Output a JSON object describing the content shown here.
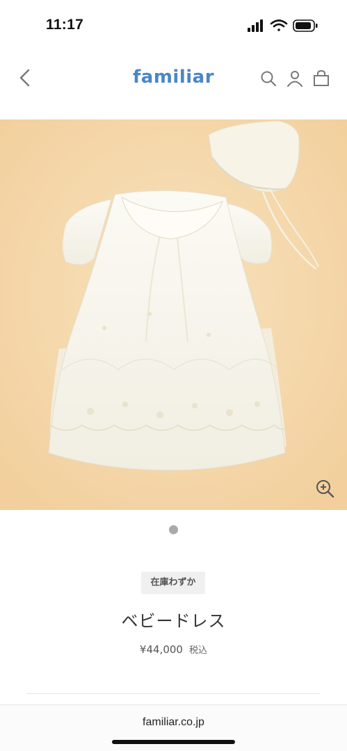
{
  "status": {
    "time": "11:17"
  },
  "header": {
    "logo": "familiar"
  },
  "icons": {
    "back": "chevron-left-icon",
    "search": "search-icon",
    "account": "user-icon",
    "cart": "shopping-bag-icon",
    "zoom": "zoom-in-icon"
  },
  "product": {
    "stock_badge": "在庫わずか",
    "name": "ベビードレス",
    "price": "¥44,000",
    "tax_label": "税込",
    "image_alt": "white embroidered baby dress with bonnet on peach background",
    "image_count": 1
  },
  "browser": {
    "url": "familiar.co.jp"
  },
  "colors": {
    "brand": "#4a86c5",
    "hero_background": "#f5d8aa",
    "dress": "#f8f6ef"
  }
}
